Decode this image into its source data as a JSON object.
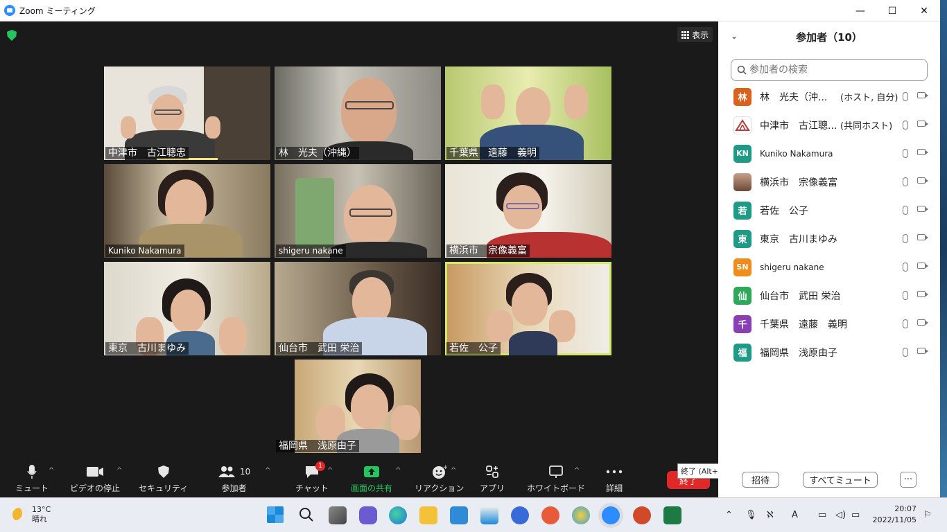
{
  "window": {
    "title": "Zoom ミーティング",
    "minimize": "—",
    "maximize": "☐",
    "close": "✕"
  },
  "meeting": {
    "view_label": "表示",
    "tiles": [
      {
        "name": "中津市　古江聰忠"
      },
      {
        "name": "林　光夫（沖縄）"
      },
      {
        "name": "千葉県　遠藤　義明"
      },
      {
        "name": "Kuniko Nakamura"
      },
      {
        "name": "shigeru nakane"
      },
      {
        "name": "横浜市　宗像義富"
      },
      {
        "name": "東京　古川まゆみ"
      },
      {
        "name": "仙台市　武田 栄治"
      },
      {
        "name": "若佐　公子"
      },
      {
        "name": "福岡県　浅原由子"
      }
    ],
    "active_speaker": "若佐　公子"
  },
  "toolbar": {
    "mute": "ミュート",
    "video": "ビデオの停止",
    "security": "セキュリティ",
    "participants": "参加者",
    "participants_count": "10",
    "chat": "チャット",
    "chat_badge": "1",
    "share": "画面の共有",
    "reactions": "リアクション",
    "apps": "アプリ",
    "whiteboard": "ホワイトボード",
    "more": "詳細",
    "end": "終了",
    "end_tooltip": "終了 (Alt+Q)"
  },
  "panel": {
    "title": "参加者（10）",
    "search_placeholder": "参加者の検索",
    "participants": [
      {
        "name": "林　光夫（沖...",
        "role": "(ホスト, 自分)",
        "avatar": "林",
        "color": "#d9621c"
      },
      {
        "name": "中津市　古江聰...",
        "role": "(共同ホスト)",
        "avatar": "",
        "color": "#b83a3a"
      },
      {
        "name": "Kuniko Nakamura",
        "role": "",
        "avatar": "KN",
        "color": "#1f9a86"
      },
      {
        "name": "横浜市　宗像義富",
        "role": "",
        "avatar": "",
        "color": "#8a5a4a"
      },
      {
        "name": "若佐　公子",
        "role": "",
        "avatar": "若",
        "color": "#1f9a86"
      },
      {
        "name": "東京　古川まゆみ",
        "role": "",
        "avatar": "東",
        "color": "#1f9a86"
      },
      {
        "name": "shigeru nakane",
        "role": "",
        "avatar": "SN",
        "color": "#f08c1a"
      },
      {
        "name": "仙台市　武田 栄治",
        "role": "",
        "avatar": "仙",
        "color": "#2fa85a"
      },
      {
        "name": "千葉県　遠藤　義明",
        "role": "",
        "avatar": "千",
        "color": "#8a3fb5"
      },
      {
        "name": "福岡県　浅原由子",
        "role": "",
        "avatar": "福",
        "color": "#1f9a86"
      }
    ],
    "invite": "招待",
    "mute_all": "すべてミュート",
    "more": "···"
  },
  "taskbar": {
    "temperature": "13°C",
    "weather": "晴れ",
    "time": "20:07",
    "date": "2022/11/05"
  }
}
